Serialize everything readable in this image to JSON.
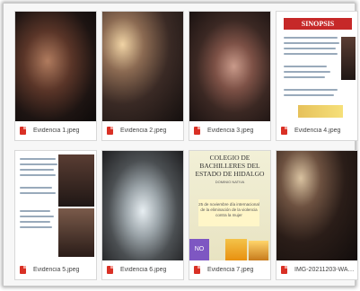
{
  "gallery": {
    "items": [
      {
        "name": "Evidencia 1.jpeg"
      },
      {
        "name": "Evidencia 2.jpeg"
      },
      {
        "name": "Evidencia 3.jpeg"
      },
      {
        "name": "Evidencia 4.jpeg"
      },
      {
        "name": "Evidencia 5.jpeg"
      },
      {
        "name": "Evidencia 6.jpeg"
      },
      {
        "name": "Evidencia 7.jpeg"
      },
      {
        "name": "IMG-20211203-WA0016.jpeg"
      }
    ]
  },
  "slides": {
    "synopsis_title": "SINOPSIS",
    "slide7_title": "COLEGIO DE BACHILLERES DEL ESTADO DE HIDALGO",
    "slide7_sub": "DOMINIO NATIVA",
    "slide7_box": "25 de noviembre día internacional de la eliminación de la violencia contra la mujer",
    "slide7_no": "NO"
  },
  "colors": {
    "file_icon": "#d93025",
    "synopsis_banner": "#c62828",
    "no_box": "#7e57c2"
  },
  "icons": {
    "file": "image-file-icon"
  }
}
